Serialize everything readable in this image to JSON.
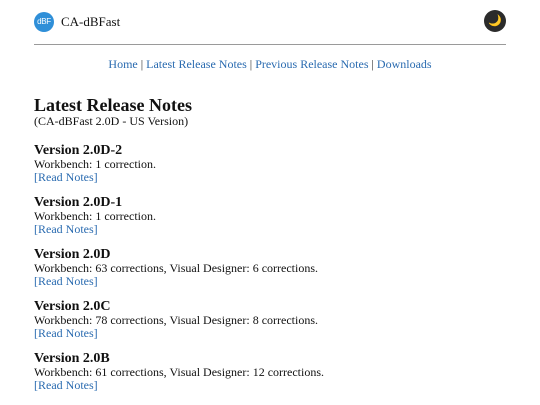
{
  "header": {
    "logo_text": "dBF",
    "site_name": "CA-dBFast",
    "theme_toggle_glyph": "🌙"
  },
  "nav": {
    "items": [
      {
        "label": "Home"
      },
      {
        "label": "Latest Release Notes"
      },
      {
        "label": "Previous Release Notes"
      },
      {
        "label": "Downloads"
      }
    ],
    "separator": "|"
  },
  "main": {
    "title": "Latest Release Notes",
    "subtitle": "(CA-dBFast 2.0D - US Version)",
    "releases": [
      {
        "version": "Version 2.0D-2",
        "summary": "Workbench: 1 correction.",
        "bracket_open": "[",
        "link_label": "Read Notes",
        "bracket_close": "]"
      },
      {
        "version": "Version 2.0D-1",
        "summary": "Workbench: 1 correction.",
        "bracket_open": "[",
        "link_label": "Read Notes",
        "bracket_close": "]"
      },
      {
        "version": "Version 2.0D",
        "summary": "Workbench: 63 corrections, Visual Designer: 6 corrections.",
        "bracket_open": "[",
        "link_label": "Read Notes",
        "bracket_close": "]"
      },
      {
        "version": "Version 2.0C",
        "summary": "Workbench: 78 corrections, Visual Designer: 8 corrections.",
        "bracket_open": "[",
        "link_label": "Read Notes",
        "bracket_close": "]"
      },
      {
        "version": "Version 2.0B",
        "summary": "Workbench: 61 corrections, Visual Designer: 12 corrections.",
        "bracket_open": "[",
        "link_label": "Read Notes",
        "bracket_close": "]"
      }
    ]
  },
  "colors": {
    "link": "#2a6bb0",
    "logo": "#2f8fd8",
    "toggle_bg": "#2b2b2b"
  }
}
